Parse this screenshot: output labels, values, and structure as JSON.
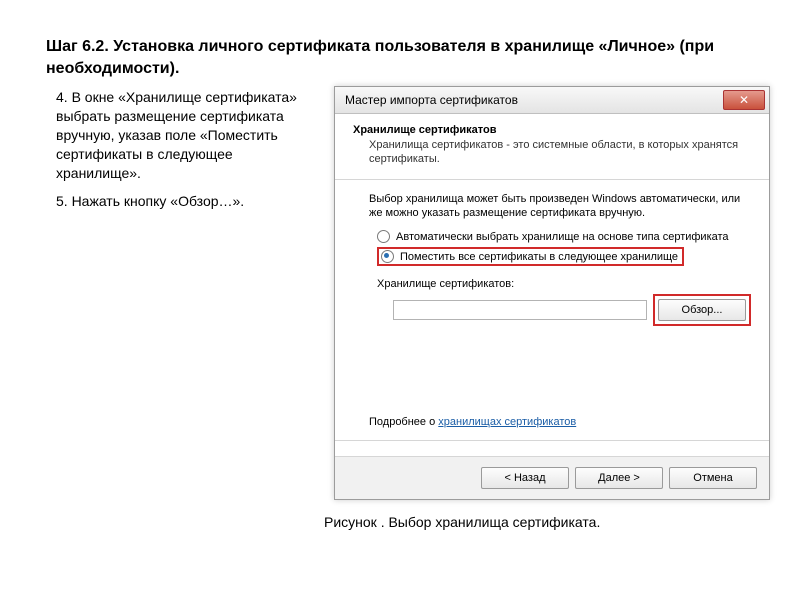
{
  "heading": "Шаг 6.2. Установка личного сертификата пользователя в хранилище «Личное» (при необходимости).",
  "instructions": {
    "p4": "4. В окне «Хранилище сертификата» выбрать размещение сертификата вручную, указав поле «Поместить сертификаты в следующее хранилище».",
    "p5": "5. Нажать кнопку «Обзор…»."
  },
  "caption": "Рисунок . Выбор хранилища сертификата.",
  "dialog": {
    "title": "Мастер импорта сертификатов",
    "section_title": "Хранилище сертификатов",
    "section_sub": "Хранилища сертификатов - это системные области, в которых хранятся сертификаты.",
    "choice_text": "Выбор хранилища может быть произведен Windows автоматически, или же можно указать размещение сертификата вручную.",
    "radio_auto": "Автоматически выбрать хранилище на основе типа сертификата",
    "radio_manual": "Поместить все сертификаты в следующее хранилище",
    "store_label": "Хранилище сертификатов:",
    "browse": "Обзор...",
    "more_prefix": "Подробнее о ",
    "more_link": "хранилищах сертификатов",
    "back": "< Назад",
    "next": "Далее >",
    "cancel": "Отмена"
  }
}
